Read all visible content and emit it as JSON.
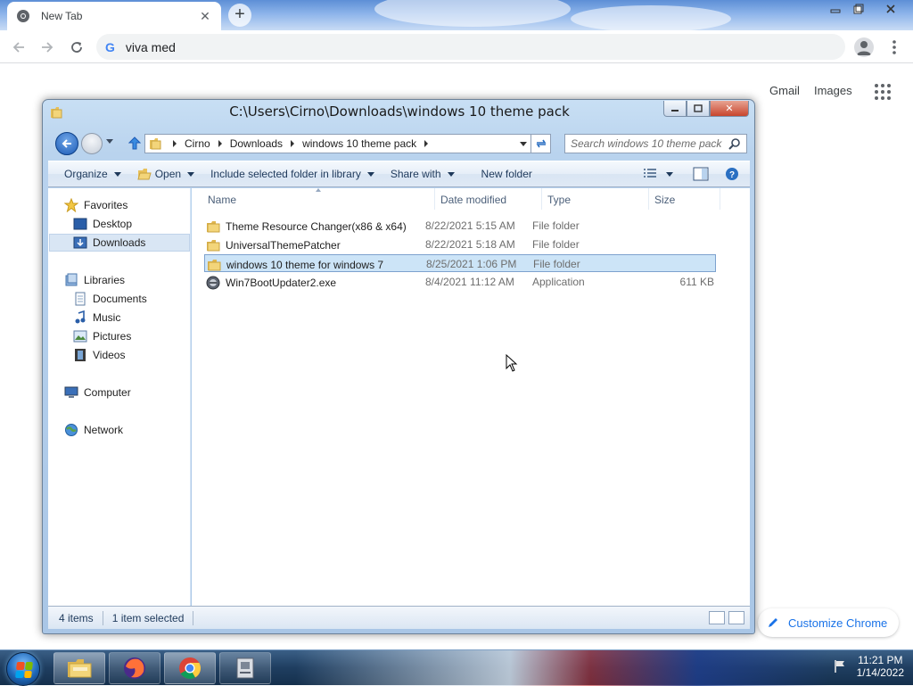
{
  "browser": {
    "tab_title": "New Tab",
    "tab_close": "✕",
    "new_tab": "+",
    "omnibox_text": "viva med",
    "omnibox_g": "G"
  },
  "ntp": {
    "gmail": "Gmail",
    "images": "Images",
    "customize": "Customize Chrome"
  },
  "explorer": {
    "title": "C:\\Users\\Cirno\\Downloads\\windows 10 theme pack",
    "caption_close": "✕",
    "breadcrumbs": [
      "Cirno",
      "Downloads",
      "windows 10 theme pack"
    ],
    "search_placeholder": "Search windows 10 theme pack",
    "commands": {
      "organize": "Organize",
      "open": "Open",
      "include": "Include selected folder in library",
      "share": "Share with",
      "new_folder": "New folder"
    },
    "nav": {
      "favorites": "Favorites",
      "desktop": "Desktop",
      "downloads": "Downloads",
      "libraries": "Libraries",
      "documents": "Documents",
      "music": "Music",
      "pictures": "Pictures",
      "videos": "Videos",
      "computer": "Computer",
      "network": "Network"
    },
    "columns": {
      "name": "Name",
      "date": "Date modified",
      "type": "Type",
      "size": "Size"
    },
    "files": [
      {
        "name": "Theme Resource Changer(x86 & x64)",
        "date": "8/22/2021 5:15 AM",
        "type": "File folder",
        "size": "",
        "icon": "folder-icon"
      },
      {
        "name": "UniversalThemePatcher",
        "date": "8/22/2021 5:18 AM",
        "type": "File folder",
        "size": "",
        "icon": "folder-icon"
      },
      {
        "name": "windows 10 theme for windows 7",
        "date": "8/25/2021 1:06 PM",
        "type": "File folder",
        "size": "",
        "icon": "folder-icon",
        "selected": true
      },
      {
        "name": "Win7BootUpdater2.exe",
        "date": "8/4/2021 11:12 AM",
        "type": "Application",
        "size": "611 KB",
        "icon": "application-icon"
      }
    ],
    "status": {
      "count": "4 items",
      "selected": "1 item selected"
    }
  },
  "taskbar": {
    "time": "11:21 PM",
    "date": "1/14/2022"
  },
  "colors": {
    "selection": "#cce4f7",
    "selection_border": "#7da2ce",
    "chrome_accent": "#1a73e8"
  }
}
